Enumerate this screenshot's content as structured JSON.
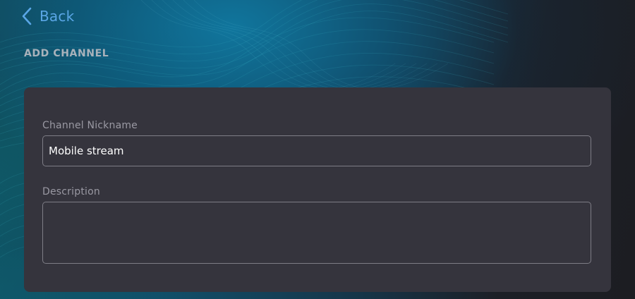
{
  "nav": {
    "back_label": "Back",
    "back_icon": "chevron-left-icon",
    "accent_color": "#5aa6e6"
  },
  "page": {
    "title": "ADD CHANNEL"
  },
  "form": {
    "nickname": {
      "label": "Channel Nickname",
      "value": "Mobile stream"
    },
    "description": {
      "label": "Description",
      "value": ""
    }
  }
}
